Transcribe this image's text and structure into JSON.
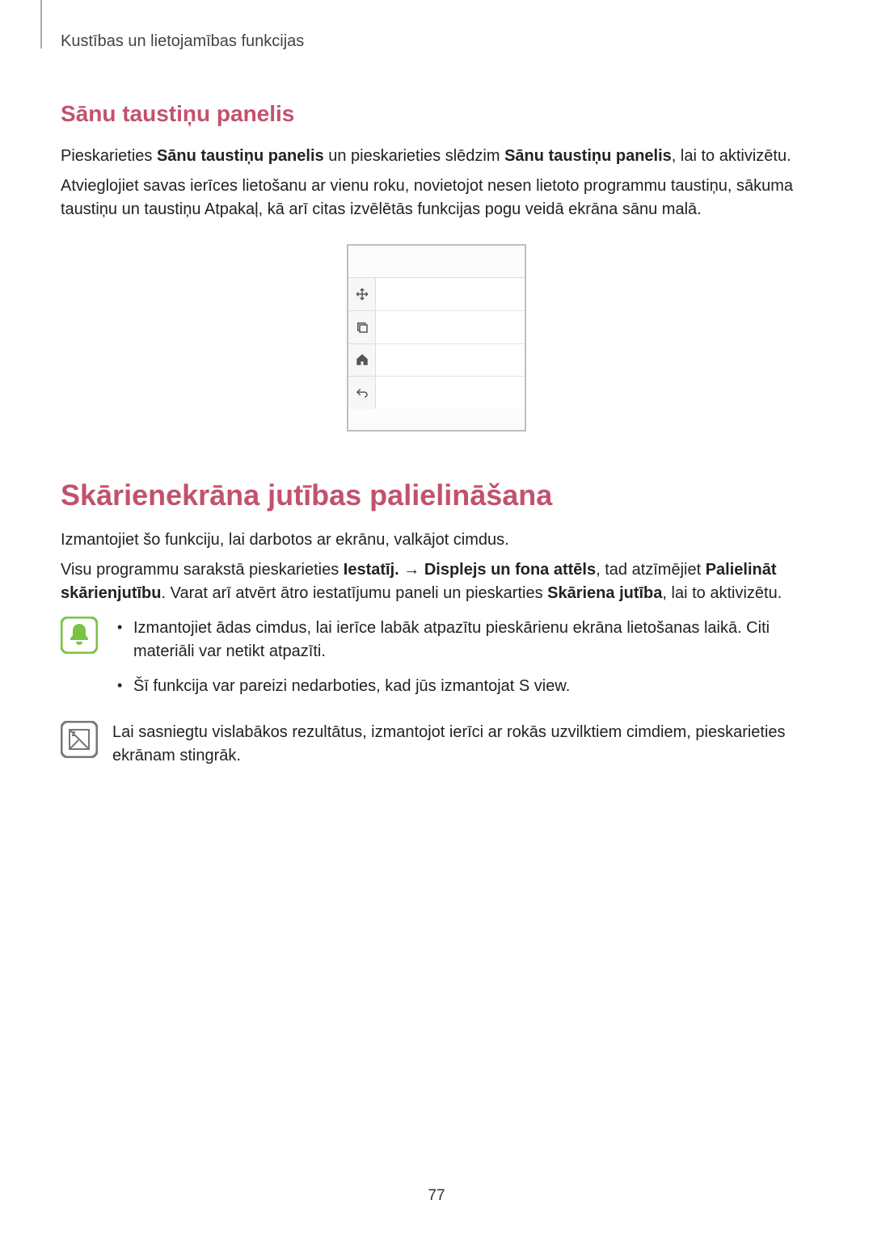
{
  "breadcrumb": "Kustības un lietojamības funkcijas",
  "section1": {
    "heading": "Sānu taustiņu panelis",
    "p1_a": "Pieskarieties ",
    "p1_b1": "Sānu taustiņu panelis",
    "p1_c": " un pieskarieties slēdzim ",
    "p1_b2": "Sānu taustiņu panelis",
    "p1_d": ", lai to aktivizētu.",
    "p2": "Atvieglojiet savas ierīces lietošanu ar vienu roku, novietojot nesen lietoto programmu taustiņu, sākuma taustiņu un taustiņu Atpakaļ, kā arī citas izvēlētās funkcijas pogu veidā ekrāna sānu malā."
  },
  "section2": {
    "heading": "Skārienekrāna jutības palielināšana",
    "p1": "Izmantojiet šo funkciju, lai darbotos ar ekrānu, valkājot cimdus.",
    "p2_a": "Visu programmu sarakstā pieskarieties ",
    "p2_b1": "Iestatīj.",
    "p2_arrow": " → ",
    "p2_b2": "Displejs un fona attēls",
    "p2_c": ", tad atzīmējiet ",
    "p2_b3": "Palielināt skārienjutību",
    "p2_d": ". Varat arī atvērt ātro iestatījumu paneli un pieskarties ",
    "p2_b4": "Skāriena jutība",
    "p2_e": ", lai to aktivizētu.",
    "note1_li1": "Izmantojiet ādas cimdus, lai ierīce labāk atpazītu pieskārienu ekrāna lietošanas laikā. Citi materiāli var netikt atpazīti.",
    "note1_li2": "Šī funkcija var pareizi nedarboties, kad jūs izmantojat S view.",
    "note2": "Lai sasniegtu vislabākos rezultātus, izmantojot ierīci ar rokās uzvilktiem cimdiem, pieskarieties ekrānam stingrāk."
  },
  "icons": {
    "move": "move-icon",
    "recents": "recents-icon",
    "home": "home-icon",
    "back": "back-icon",
    "bell": "notice-bell-icon",
    "note": "note-icon"
  },
  "page_number": "77"
}
